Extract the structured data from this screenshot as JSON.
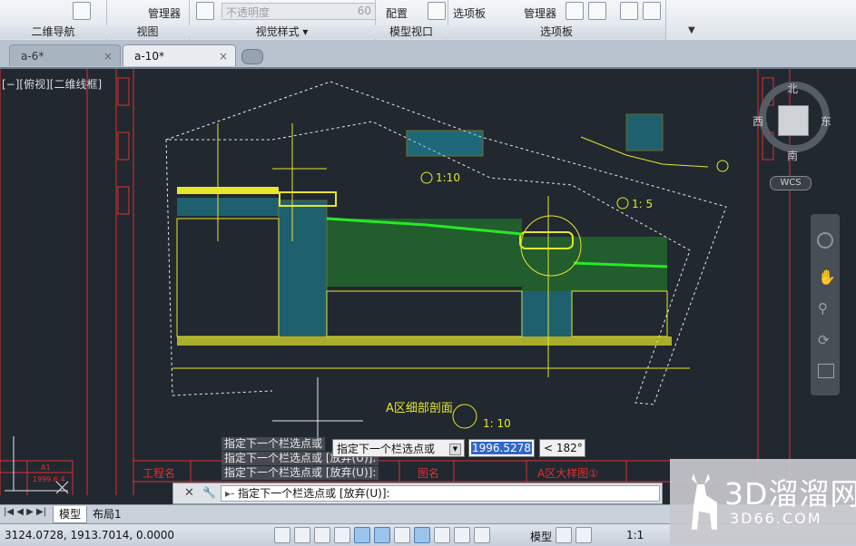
{
  "ribbon": {
    "sections": [
      {
        "title": "二维导航"
      },
      {
        "title": "视图"
      },
      {
        "title": "视觉样式",
        "dropdown": true
      },
      {
        "title": "模型视口"
      },
      {
        "title": "选项板"
      }
    ],
    "items": {
      "view_manager": "管理器",
      "opacity_placeholder": "不透明度",
      "opacity_value": "60",
      "config": "配置",
      "palette": "选项板",
      "sheet_manager": "管理器"
    }
  },
  "tabs": [
    {
      "label": "a-6*",
      "active": false
    },
    {
      "label": "a-10*",
      "active": true
    }
  ],
  "viewport": {
    "label": "[−][俯视][二维线框]",
    "compass": {
      "north": "北",
      "south": "南",
      "east": "东",
      "west": "西"
    },
    "wcs": "WCS",
    "drawing": {
      "title_section": "A区细部剖面",
      "scale_1_10": "1: 10",
      "detail3": "1:10",
      "detail2": "1: 5",
      "title_block": {
        "project_label": "工程名",
        "drawing_label": "图名",
        "drawing_name": "A区大样图①",
        "left_block_1": "A1",
        "left_block_2": "1999.6.4"
      }
    }
  },
  "command": {
    "history": [
      "指定下一个栏选点或",
      "指定下一个栏选点或 [放弃(U)]:",
      "指定下一个栏选点或 [放弃(U)]:"
    ],
    "tooltip": "指定下一个栏选点或",
    "value": "1996.5278",
    "angle": "< 182°",
    "prompt": "指定下一个栏选点或 [放弃(U)]:"
  },
  "layout_tabs": [
    {
      "label": "模型"
    },
    {
      "label": "布局1"
    }
  ],
  "status": {
    "coords": "3124.0728, 1913.7014, 0.0000",
    "model": "模型",
    "scale": "1:1"
  },
  "watermark": {
    "main": "3D溜溜网",
    "sub": "3D66.COM"
  },
  "colors": {
    "canvas_bg": "#212830",
    "drawing_yellow": "#e6e62a",
    "drawing_red": "#e03030",
    "drawing_green": "#28e828",
    "drawing_cyan": "#1ec8e6"
  }
}
